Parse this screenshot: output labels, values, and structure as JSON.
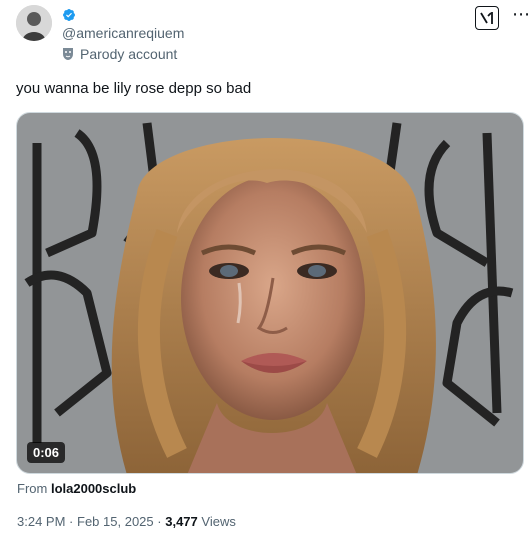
{
  "tweet": {
    "handle": "@americanreqiuem",
    "account_label": "Parody account",
    "text": "you wanna be lily rose depp so bad",
    "video_duration": "0:06",
    "source_prefix": "From",
    "source_account": "lola2000sclub",
    "time": "3:24 PM",
    "date": "Feb 15, 2025",
    "separator": "·",
    "views_count": "3,477",
    "views_label": "Views"
  },
  "colors": {
    "verified": "#1d9bf0",
    "secondary_text": "#536471",
    "primary_text": "#0f1419"
  },
  "icons": {
    "verified": "verified-badge-icon",
    "parody": "parody-mask-icon",
    "grok": "grok-icon",
    "more": "more-icon"
  }
}
